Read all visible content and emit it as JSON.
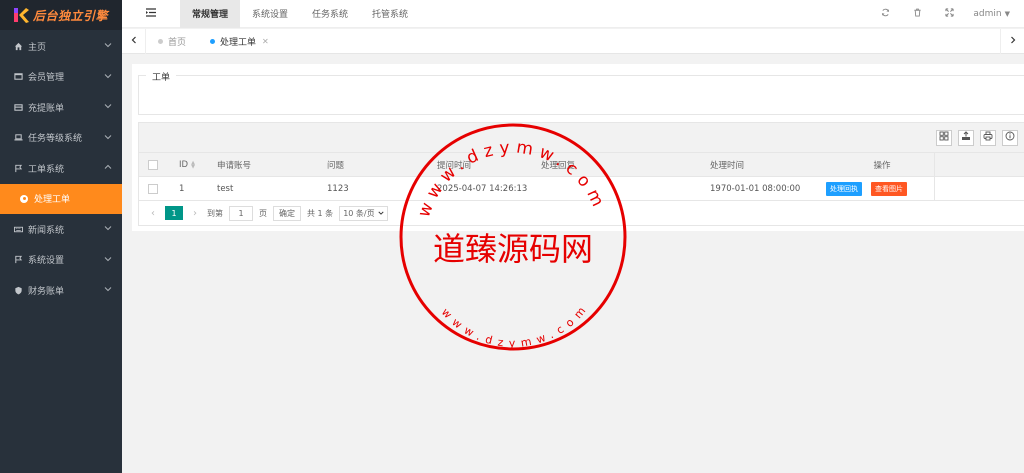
{
  "app": {
    "logo_text": "后台独立引擎"
  },
  "sidebar": {
    "items": [
      {
        "label": "主页",
        "icon": "home-icon"
      },
      {
        "label": "会员管理",
        "icon": "monitor-icon"
      },
      {
        "label": "充提账单",
        "icon": "card-icon"
      },
      {
        "label": "任务等级系统",
        "icon": "laptop-icon"
      },
      {
        "label": "工单系统",
        "icon": "flag-icon",
        "expanded": true
      },
      {
        "label": "处理工单",
        "active": true
      },
      {
        "label": "新闻系统",
        "icon": "keyboard-icon"
      },
      {
        "label": "系统设置",
        "icon": "flag-icon"
      },
      {
        "label": "财务账单",
        "icon": "shield-icon"
      }
    ]
  },
  "header": {
    "tabs": [
      "常规管理",
      "系统设置",
      "任务系统",
      "托管系统"
    ],
    "active_tab": "常规管理",
    "user": "admin"
  },
  "page_tabs": {
    "home": "首页",
    "current": "处理工单"
  },
  "panel": {
    "legend": "工单"
  },
  "table": {
    "headers": {
      "id": "ID",
      "user": "申请账号",
      "question": "问题",
      "submit_time": "提问时间",
      "reply": "处理回复",
      "handle_time": "处理时间",
      "actions": "操作"
    },
    "rows": [
      {
        "id": "1",
        "user": "test",
        "question": "1123",
        "submit_time": "2025-04-07 14:26:13",
        "reply": "",
        "handle_time": "1970-01-01 08:00:00",
        "btn_handle": "处理回执",
        "btn_view": "查看图片"
      }
    ]
  },
  "pager": {
    "current_page": "1",
    "goto_label": "到第",
    "goto_value": "1",
    "page_unit": "页",
    "confirm": "确定",
    "total": "共 1 条",
    "page_size": "10 条/页"
  },
  "watermark": {
    "center_text": "道臻源码网",
    "ring_top": "www.dzymw.com",
    "ring_bottom": "www.dzymw.com",
    "color": "#e60000"
  },
  "colors": {
    "sidebar_bg": "#28313b",
    "accent_orange": "#ff8a1c",
    "btn_blue": "#1e9fff",
    "btn_red": "#ff5722",
    "pager_teal": "#009688"
  }
}
